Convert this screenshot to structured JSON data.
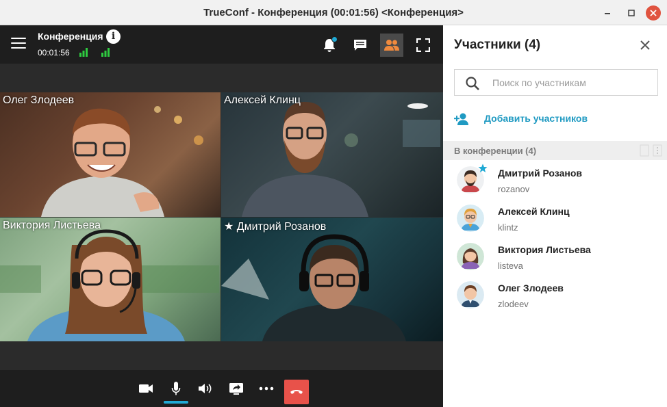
{
  "window": {
    "title": "TrueConf - Конференция (00:01:56) <Конференция>"
  },
  "conference": {
    "name": "Конференция",
    "time": "00:01:56"
  },
  "tiles": [
    {
      "name": "Олег Злодеев"
    },
    {
      "name": "Алексей Клинц"
    },
    {
      "name": "Виктория Листьева"
    },
    {
      "name": "★ Дмитрий Розанов"
    }
  ],
  "controls": {
    "mic_level": 1.0
  },
  "panel": {
    "title": "Участники (4)",
    "search_placeholder": "Поиск по участникам",
    "add_label": "Добавить участников",
    "section_label": "В конференции (4)",
    "participants": [
      {
        "name": "Дмитрий Розанов",
        "login": "rozanov"
      },
      {
        "name": "Алексей Клинц",
        "login": "klintz"
      },
      {
        "name": "Виктория Листьева",
        "login": "listeva"
      },
      {
        "name": "Олег Злодеев",
        "login": "zlodeev"
      }
    ]
  },
  "colors": {
    "accent": "#1f9ac2",
    "hangup": "#e8524a",
    "signal": "#2ecc40"
  }
}
